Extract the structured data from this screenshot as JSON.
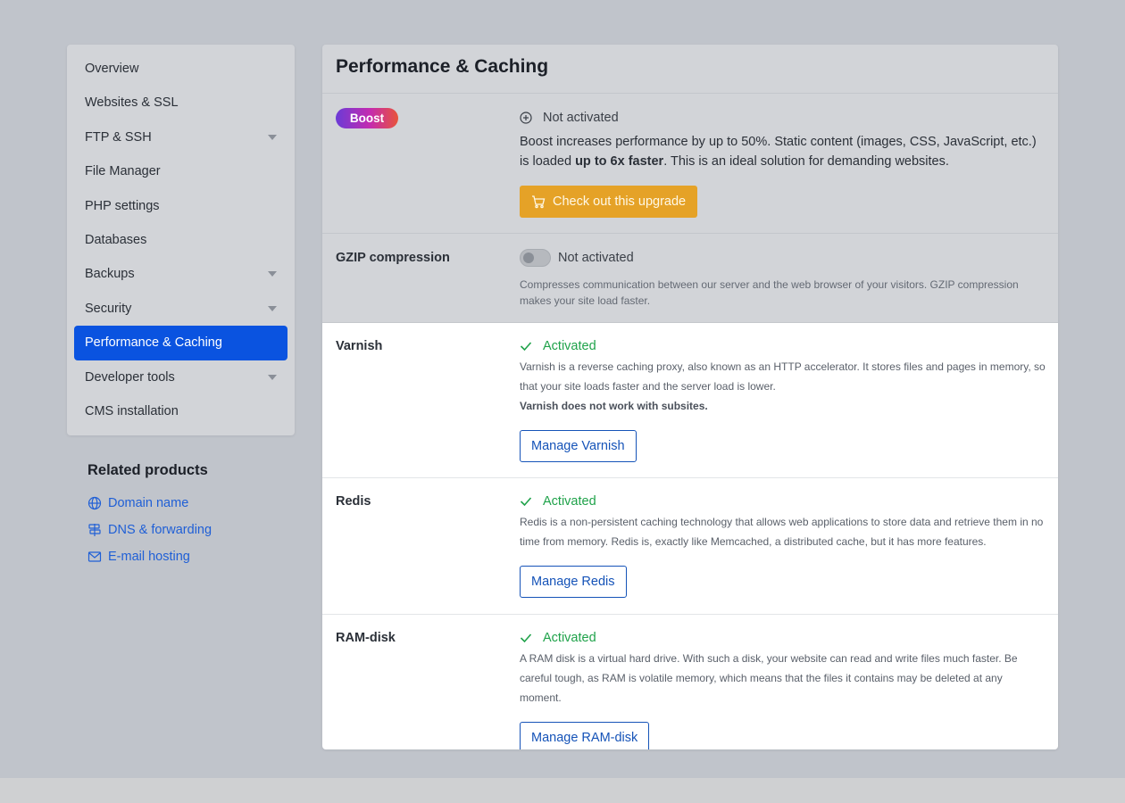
{
  "sidebar": {
    "items": [
      {
        "label": "Overview",
        "has_caret": false,
        "active": false
      },
      {
        "label": "Websites & SSL",
        "has_caret": false,
        "active": false
      },
      {
        "label": "FTP & SSH",
        "has_caret": true,
        "active": false
      },
      {
        "label": "File Manager",
        "has_caret": false,
        "active": false
      },
      {
        "label": "PHP settings",
        "has_caret": false,
        "active": false
      },
      {
        "label": "Databases",
        "has_caret": false,
        "active": false
      },
      {
        "label": "Backups",
        "has_caret": true,
        "active": false
      },
      {
        "label": "Security",
        "has_caret": true,
        "active": false
      },
      {
        "label": "Performance & Caching",
        "has_caret": false,
        "active": true
      },
      {
        "label": "Developer tools",
        "has_caret": true,
        "active": false
      },
      {
        "label": "CMS installation",
        "has_caret": false,
        "active": false
      }
    ]
  },
  "related": {
    "title": "Related products",
    "links": [
      {
        "label": "Domain name",
        "icon": "globe-icon"
      },
      {
        "label": "DNS & forwarding",
        "icon": "signpost-icon"
      },
      {
        "label": "E-mail hosting",
        "icon": "mail-icon"
      }
    ]
  },
  "main": {
    "title": "Performance & Caching",
    "boost": {
      "badge": "Boost",
      "status": "Not activated",
      "desc_pre": "Boost increases performance by up to 50%. Static content (images, CSS, JavaScript, etc.) is loaded ",
      "desc_bold": "up to 6x faster",
      "desc_post": ". This is an ideal solution for demanding websites.",
      "button": "Check out this upgrade"
    },
    "gzip": {
      "label": "GZIP compression",
      "status": "Not activated",
      "enabled": false,
      "desc": "Compresses communication between our server and the web browser of your visitors. GZIP compression makes your site load faster."
    },
    "varnish": {
      "label": "Varnish",
      "status": "Activated",
      "desc": "Varnish is a reverse caching proxy, also known as an HTTP accelerator. It stores files and pages in memory, so that your site loads faster and the server load is lower.",
      "note": "Varnish does not work with subsites.",
      "button": "Manage Varnish"
    },
    "redis": {
      "label": "Redis",
      "status": "Activated",
      "desc": "Redis is a non-persistent caching technology that allows web applications to store data and retrieve them in no time from memory. Redis is, exactly like Memcached, a distributed cache, but it has more features.",
      "button": "Manage Redis"
    },
    "ramdisk": {
      "label": "RAM-disk",
      "status": "Activated",
      "desc": "A RAM disk is a virtual hard drive. With such a disk, your website can read and write files much faster. Be careful tough, as RAM is volatile memory, which means that the files it contains may be deleted at any moment.",
      "button": "Manage RAM-disk"
    }
  },
  "colors": {
    "accent": "#0a53e0",
    "activated": "#1fa24a",
    "upgrade": "#e5a227",
    "link": "#1f5fd6"
  }
}
